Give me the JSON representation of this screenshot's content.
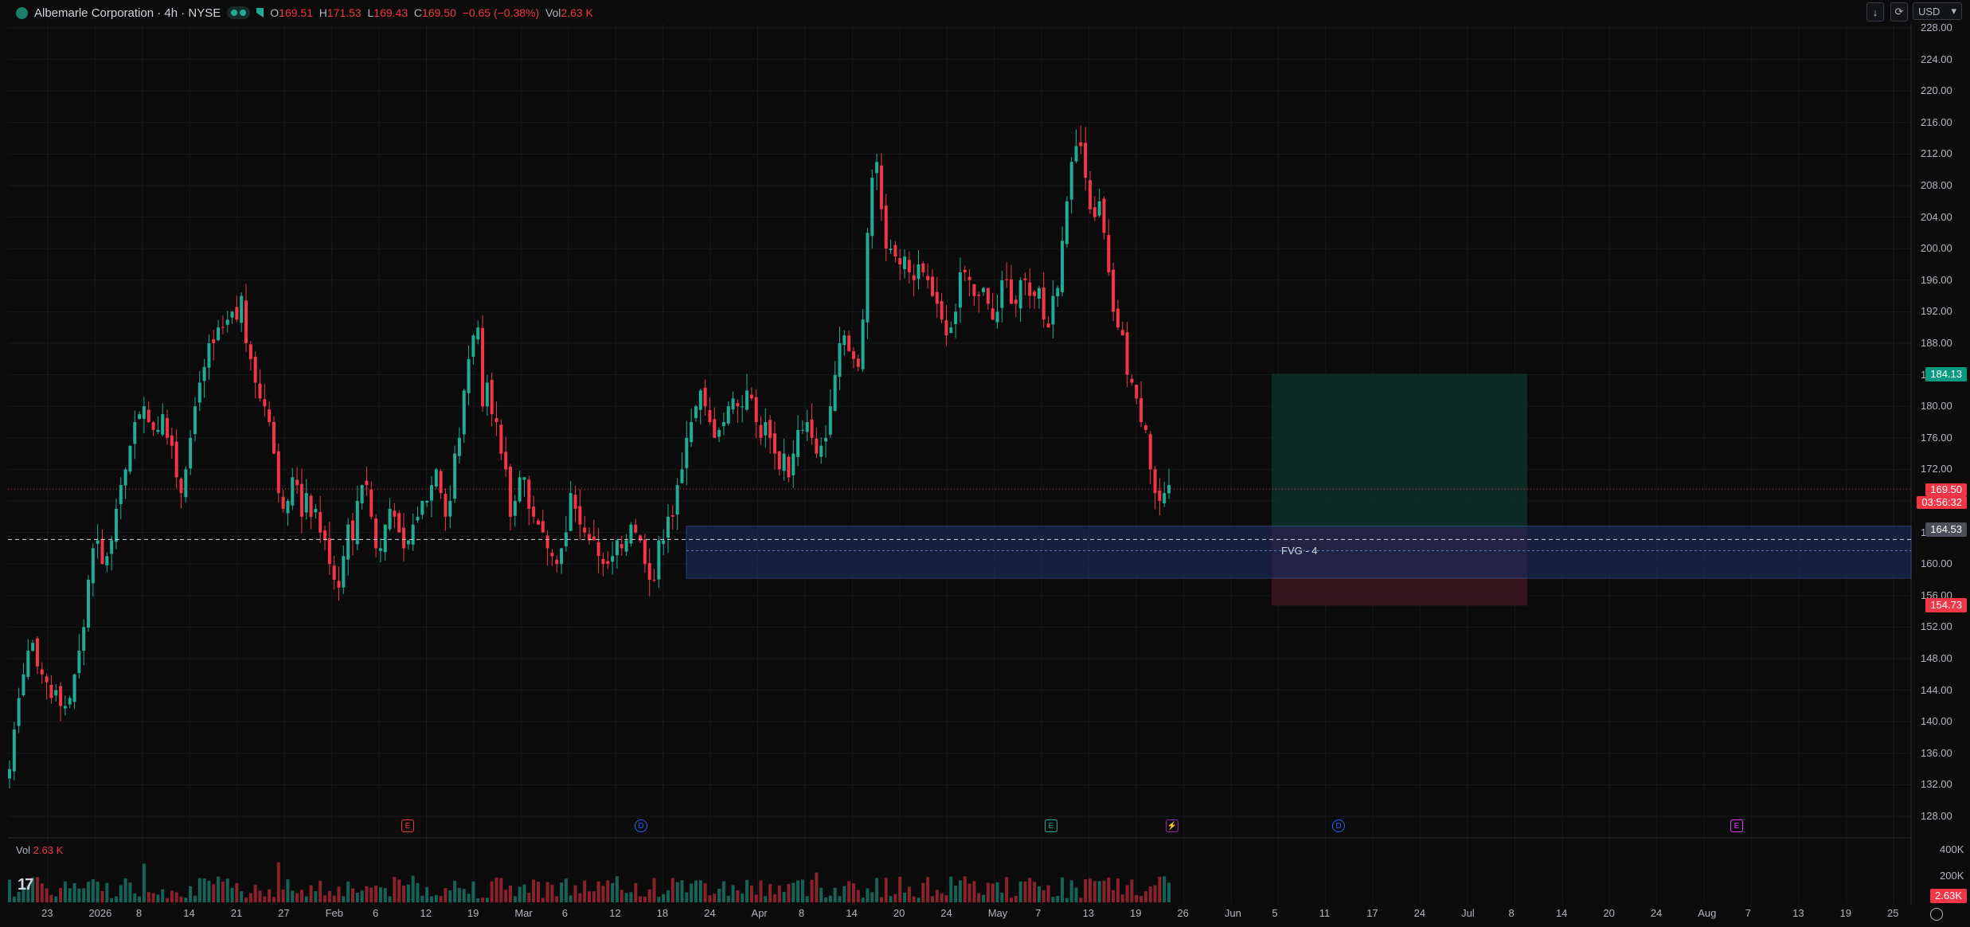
{
  "header": {
    "symbol": "Albemarle Corporation · 4h · NYSE",
    "ohlc": {
      "o_label": "O",
      "o": "169.51",
      "h_label": "H",
      "h": "171.53",
      "l_label": "L",
      "l": "169.43",
      "c_label": "C",
      "c": "169.50",
      "change": "−0.65 (−0.38%)",
      "vol_label": "Vol",
      "vol": "2.63 K"
    }
  },
  "toolbar": {
    "download_icon": "↓",
    "sync_icon": "⟳",
    "currency": "USD",
    "currency_caret": "▾"
  },
  "price_axis": [
    "228.00",
    "224.00",
    "220.00",
    "216.00",
    "212.00",
    "208.00",
    "204.00",
    "200.00",
    "196.00",
    "192.00",
    "188.00",
    "184.00",
    "180.00",
    "176.00",
    "172.00",
    "168.00",
    "164.00",
    "160.00",
    "156.00",
    "152.00",
    "148.00",
    "144.00",
    "140.00",
    "136.00",
    "132.00",
    "128.00"
  ],
  "price_tags": {
    "target": "184.13",
    "last_price": "169.50",
    "countdown": "03:56:32",
    "entry": "164.53",
    "stop": "154.73"
  },
  "volume_axis": {
    "v1": "400K",
    "v2": "200K",
    "current": "2.63K"
  },
  "volume_label": {
    "label": "Vol",
    "value": "2.63 K"
  },
  "time_axis": [
    "23",
    "2026",
    "8",
    "14",
    "21",
    "27",
    "Feb",
    "6",
    "12",
    "19",
    "Mar",
    "6",
    "12",
    "18",
    "24",
    "Apr",
    "8",
    "14",
    "20",
    "24",
    "May",
    "7",
    "13",
    "19",
    "26",
    "Jun",
    "5",
    "11",
    "17",
    "24",
    "Jul",
    "8",
    "14",
    "20",
    "24",
    "Aug",
    "7",
    "13",
    "19",
    "25"
  ],
  "drawings": {
    "fvg_label": "FVG - 4"
  },
  "events": [
    {
      "letter": "E",
      "color": "#f23645"
    },
    {
      "letter": "D",
      "color": "#2962ff"
    },
    {
      "letter": "E",
      "color": "#22ab94"
    },
    {
      "letter": "⚡",
      "color": "#9c27b0"
    },
    {
      "letter": "D",
      "color": "#2962ff"
    },
    {
      "letter": "E",
      "color": "#e040fb"
    }
  ],
  "colors": {
    "up": "#22ab94",
    "down": "#f23645",
    "background": "#0b0b0c",
    "grid": "#16181c",
    "fvg": "#1b2b5a",
    "target_zone": "#0f2e27",
    "stop_zone": "#3a1520"
  },
  "chart_data": {
    "type": "candlestick",
    "interval": "4h",
    "price_range": [
      126,
      229
    ],
    "last_close": 169.5,
    "key_levels": {
      "take_profit": 184.13,
      "entry": 164.53,
      "stop": 154.73
    },
    "fvg_zone": [
      158.2,
      164.8
    ],
    "closes": [
      134,
      139,
      143,
      146,
      149,
      150,
      147,
      146,
      145,
      143,
      144,
      142,
      142,
      143,
      146,
      149,
      152,
      158,
      162,
      163,
      160,
      161,
      163,
      167,
      170,
      172,
      175,
      178,
      179,
      180,
      178,
      177,
      177,
      179,
      176,
      175,
      171,
      169,
      172,
      176,
      180,
      183,
      185,
      188,
      188,
      190,
      190,
      191,
      192,
      191,
      194,
      188,
      186,
      183,
      181,
      180,
      178,
      174,
      169,
      167,
      168,
      171,
      170,
      166,
      169,
      166,
      167,
      164,
      163,
      160,
      158,
      157,
      161,
      165,
      163,
      168,
      170,
      170,
      166,
      162,
      162,
      165,
      167,
      166,
      164,
      162,
      163,
      165,
      166,
      168,
      168,
      170,
      172,
      169,
      166,
      168,
      174,
      176,
      182,
      186,
      189,
      190,
      180,
      183,
      179,
      178,
      174,
      172,
      166,
      168,
      171,
      171,
      167,
      166,
      165,
      164,
      162,
      161,
      160,
      162,
      164,
      169,
      167,
      165,
      164,
      163,
      163,
      161,
      160,
      160,
      161,
      163,
      162,
      163,
      165,
      164,
      163,
      160,
      158,
      158,
      163,
      163,
      166,
      166,
      170,
      172,
      176,
      178,
      180,
      182,
      180,
      178,
      176,
      177,
      178,
      180,
      181,
      180,
      180,
      182,
      181,
      178,
      176,
      178,
      176,
      174,
      172,
      174,
      171,
      174,
      177,
      177,
      178,
      176,
      174,
      175,
      176,
      180,
      184,
      188,
      189,
      187,
      186,
      185,
      191,
      202,
      209,
      211,
      205,
      200,
      200,
      199,
      198,
      199,
      197,
      196,
      198,
      197,
      196,
      194,
      193,
      191,
      189,
      190,
      192,
      197,
      197,
      196,
      194,
      194,
      195,
      193,
      191,
      192,
      196,
      196,
      193,
      193,
      196,
      196,
      194,
      194,
      195,
      191,
      190,
      194,
      195,
      201,
      206,
      211,
      213,
      213,
      209,
      205,
      204,
      206,
      202,
      197,
      192,
      190,
      189,
      184,
      183,
      181,
      178,
      177,
      172,
      169,
      168,
      169,
      170
    ]
  }
}
